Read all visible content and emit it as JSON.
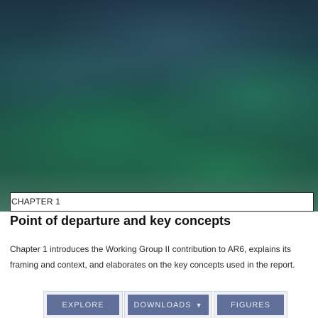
{
  "hero": {
    "description": ""
  },
  "chapter": {
    "label": "CHAPTER 1",
    "title": "Point of departure and key concepts",
    "description": "Chapter 1 introduces the Working Group II contribution to AR6, explains its framing and context, and elaborates on the key concepts used in the report."
  },
  "actions": {
    "explore_label": "EXPLORE",
    "downloads_label": "DOWNLOADS",
    "downloads_caret": "chevron-down-icon",
    "figures_label": "FIGURES"
  },
  "colors": {
    "button_bg": "#5f6f9a",
    "button_text": "#e9ecf5",
    "hero_green": "#1e5a48"
  }
}
